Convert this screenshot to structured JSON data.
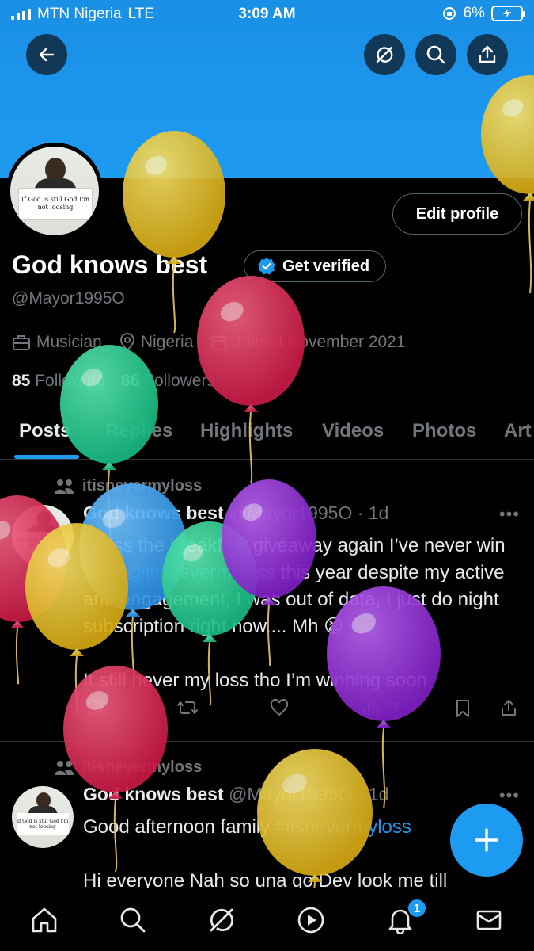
{
  "status_bar": {
    "carrier": "MTN Nigeria",
    "network": "LTE",
    "time": "3:09 AM",
    "battery": "6%"
  },
  "profile": {
    "avatar_card_text": "If God is still God I'm not loosing",
    "edit_profile_label": "Edit profile",
    "name": "God knows best",
    "get_verified_label": "Get verified",
    "handle": "@Mayor1995O",
    "profession": "Musician",
    "location": "Nigeria",
    "joined": "Joined November 2021",
    "following_count": "85",
    "following_label": "Following",
    "followers_count": "86",
    "followers_label": "Followers"
  },
  "tabs": [
    "Posts",
    "Replies",
    "Highlights",
    "Videos",
    "Photos",
    "Art"
  ],
  "posts": [
    {
      "reposted_by": "itisnevermyloss",
      "author": "God knows best",
      "meta": "@Mayor1995O · 1d",
      "text_1": "I miss the breakfast giveaway again I’ve never win from ",
      "mention": "@itisnevermyloss",
      "text_2": " this year despite my active and engagement, I was out of data, I just do night subscription right now.... Mh 😫",
      "text_3": "It still never my loss tho I’m winning soon",
      "views": "17"
    },
    {
      "reposted_by": "itisnevermyloss",
      "author": "God knows best",
      "meta": "@Mayor1995O · 1d",
      "text_1": "Good afternoon family ",
      "hashtag": "#itsnevermyloss",
      "text_2": "Hi everyone Nah so una go Dev look me till"
    }
  ],
  "bottom_nav": {
    "notifications_badge": "1"
  },
  "colors": {
    "accent": "#1d9bf0",
    "banner": "#1d9bf0",
    "muted": "#71767b"
  }
}
